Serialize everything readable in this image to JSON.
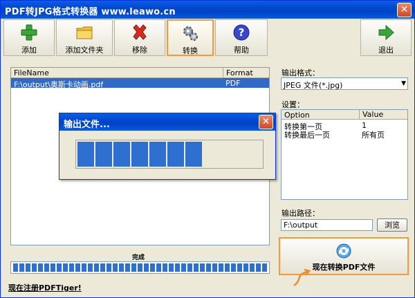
{
  "window": {
    "title": "PDF转JPG格式转换器 www.leawo.cn",
    "close_glyph": "✕"
  },
  "toolbar": {
    "add": "添加",
    "add_folder": "添加文件夹",
    "remove": "移除",
    "convert": "转换",
    "help": "帮助",
    "exit": "退出"
  },
  "file_list": {
    "columns": [
      "FileName",
      "Format"
    ],
    "rows": [
      {
        "name": "F:\\output\\奥斯卡动画.pdf",
        "format": "PDF"
      }
    ]
  },
  "dialog": {
    "title": "输出文件...",
    "close_glyph": "✕",
    "segments_filled": 7
  },
  "output_format": {
    "label": "输出格式：",
    "value": "JPEG 文件(*.jpg)",
    "arrow": "▼"
  },
  "settings": {
    "label": "设置：",
    "columns": [
      "Option",
      "Value"
    ],
    "rows": [
      {
        "option": "转换第一页",
        "value": "1"
      },
      {
        "option": "转换最后一页",
        "value": "所有页"
      }
    ]
  },
  "output_path": {
    "label": "输出路径：",
    "value": "F:\\output",
    "browse": "浏览"
  },
  "convert_now": "现在转换PDF文件",
  "status": {
    "done_label": "完成",
    "progress": 1.0
  },
  "register_link": "现在注册PDFTiger!"
}
